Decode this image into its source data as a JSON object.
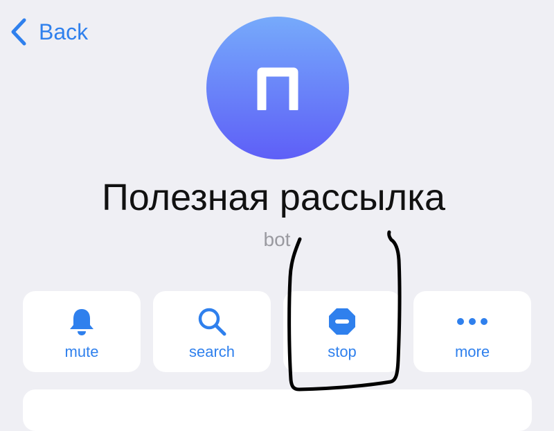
{
  "nav": {
    "back_label": "Back"
  },
  "profile": {
    "avatar_letter": "п",
    "name": "Полезная рассылка",
    "subtitle": "bot"
  },
  "actions": [
    {
      "label": "mute",
      "icon": "bell-icon"
    },
    {
      "label": "search",
      "icon": "magnifier-icon"
    },
    {
      "label": "stop",
      "icon": "stop-icon"
    },
    {
      "label": "more",
      "icon": "ellipsis-icon"
    }
  ],
  "colors": {
    "accent": "#2f80ed",
    "background": "#efeff4",
    "card": "#ffffff",
    "avatar_top": "#76aafb",
    "avatar_bottom": "#5e5ff7",
    "subtitle": "#9a9aa0",
    "annotation": "#000000"
  }
}
